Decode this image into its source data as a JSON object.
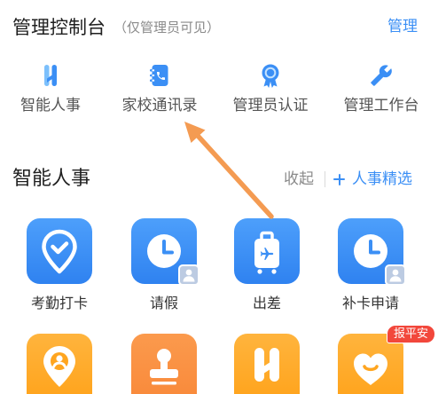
{
  "colors": {
    "accent_blue": "#3b8ff5",
    "app_blue_top": "#4d9ffb",
    "app_blue_bottom": "#2f82f0",
    "app_orange": "#ffa51f",
    "stamp_orange": "#f98b3c",
    "tag_red": "#f2473b",
    "arrow_orange": "#f49b52",
    "text_dark": "#1f1f1f",
    "text_gray": "#8a8a8a"
  },
  "console": {
    "title": "管理控制台",
    "subtitle": "（仅管理员可见）",
    "manage_label": "管理",
    "items": [
      {
        "label": "智能人事",
        "icon": "smart-hr-logo-icon"
      },
      {
        "label": "家校通讯录",
        "icon": "address-book-icon"
      },
      {
        "label": "管理员认证",
        "icon": "certificate-badge-icon"
      },
      {
        "label": "管理工作台",
        "icon": "wrench-icon"
      }
    ]
  },
  "hr": {
    "title": "智能人事",
    "collapse_label": "收起",
    "picks_icon": "plus-icon",
    "picks_label": "人事精选",
    "apps": [
      {
        "label": "考勤打卡",
        "icon": "location-check-icon"
      },
      {
        "label": "请假",
        "icon": "clock-icon",
        "badge_icon": "person-badge-icon"
      },
      {
        "label": "出差",
        "icon": "luggage-plane-icon"
      },
      {
        "label": "补卡申请",
        "icon": "clock-icon",
        "badge_icon": "person-badge-icon"
      },
      {
        "icon": "location-person-icon"
      },
      {
        "icon": "stamp-icon"
      },
      {
        "icon": "hr-logo-icon"
      },
      {
        "icon": "heart-smile-icon",
        "tag": "报平安"
      }
    ]
  },
  "annotation_icon": "pointer-arrow-icon"
}
